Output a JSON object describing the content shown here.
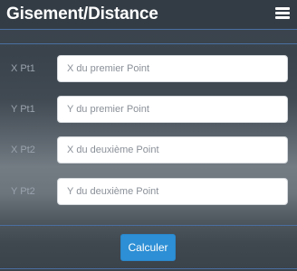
{
  "header": {
    "title": "Gisement/Distance",
    "menu_icon": "hamburger-menu-icon"
  },
  "form": {
    "fields": [
      {
        "label": "X Pt1",
        "placeholder": "X du premier Point",
        "value": ""
      },
      {
        "label": "Y Pt1",
        "placeholder": "Y du premier Point",
        "value": ""
      },
      {
        "label": "X Pt2",
        "placeholder": "X du deuxième Point",
        "value": ""
      },
      {
        "label": "Y Pt2",
        "placeholder": "Y du deuxième Point",
        "value": ""
      }
    ],
    "submit_label": "Calculer"
  },
  "colors": {
    "header_bg": "#333c45",
    "divider": "#4a6fa0",
    "button_bg": "#2d8fd5",
    "label_text": "#9aa3ad"
  }
}
